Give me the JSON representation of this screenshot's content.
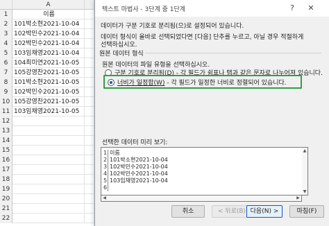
{
  "sheet": {
    "corner": "",
    "col_a": "A",
    "col_b": "",
    "rows": [
      {
        "num": "1",
        "value": "이름"
      },
      {
        "num": "2",
        "value": "101박소현2021-10-04"
      },
      {
        "num": "3",
        "value": "102박민수2021-10-04"
      },
      {
        "num": "4",
        "value": "102박민수2021-10-04"
      },
      {
        "num": "5",
        "value": "103임채영2021-10-04"
      },
      {
        "num": "6",
        "value": "104최미연2021-10-05"
      },
      {
        "num": "7",
        "value": "105강영찬2021-10-05"
      },
      {
        "num": "8",
        "value": "101박소현2021-10-05"
      },
      {
        "num": "9",
        "value": "102박민수2021-10-05"
      },
      {
        "num": "10",
        "value": "105강영찬2021-10-05"
      },
      {
        "num": "11",
        "value": "103임채영2021-10-05"
      },
      {
        "num": "12",
        "value": ""
      },
      {
        "num": "13",
        "value": ""
      },
      {
        "num": "14",
        "value": ""
      },
      {
        "num": "15",
        "value": ""
      },
      {
        "num": "16",
        "value": ""
      },
      {
        "num": "17",
        "value": ""
      },
      {
        "num": "18",
        "value": ""
      },
      {
        "num": "19",
        "value": ""
      },
      {
        "num": "20",
        "value": ""
      },
      {
        "num": "21",
        "value": ""
      },
      {
        "num": "22",
        "value": ""
      }
    ]
  },
  "dialog": {
    "title": "텍스트 마법사 - 3단계 중 1단계",
    "help": "?",
    "close": "✕",
    "intro_line1": "데이터가 구분 기호로 분리됨(으)로 설정되어 있습니다.",
    "intro_line2": "데이터 형식이 올바로 선택되었다면 [다음] 단추를 누르고, 아닐 경우 적절하게",
    "intro_line3": "선택하십시오.",
    "group_title": "원본 데이터 형식",
    "group_prompt": "원본 데이터의 파일 유형을 선택하십시오.",
    "option_delimited_label": "구분 기호로 분리됨(D)",
    "option_delimited_desc": " - 각 필드가 쉼표나 탭과 같은 문자로 나누어져 있습니다.",
    "option_fixed_label": "너비가 일정함(W)",
    "option_fixed_desc": " - 각 필드가 일정한 너비로 정렬되어 있습니다.",
    "selected_option": "fixed",
    "preview_label": "선택한 데이터 미리 보기:",
    "preview_rows": [
      {
        "num": "1",
        "value": "이름"
      },
      {
        "num": "2",
        "value": "101박소현2021-10-04"
      },
      {
        "num": "3",
        "value": "102박민수2021-10-04"
      },
      {
        "num": "4",
        "value": "102박민수2021-10-04"
      },
      {
        "num": "5",
        "value": "103임채영2021-10-04"
      },
      {
        "num": "6",
        "value": ""
      }
    ],
    "buttons": {
      "cancel": "취소",
      "back": "< 뒤로(B)",
      "next": "다음(N) >",
      "finish": "마침(F)"
    }
  },
  "colors": {
    "highlight": "#2ea043",
    "primary_border": "#0b57d0"
  }
}
